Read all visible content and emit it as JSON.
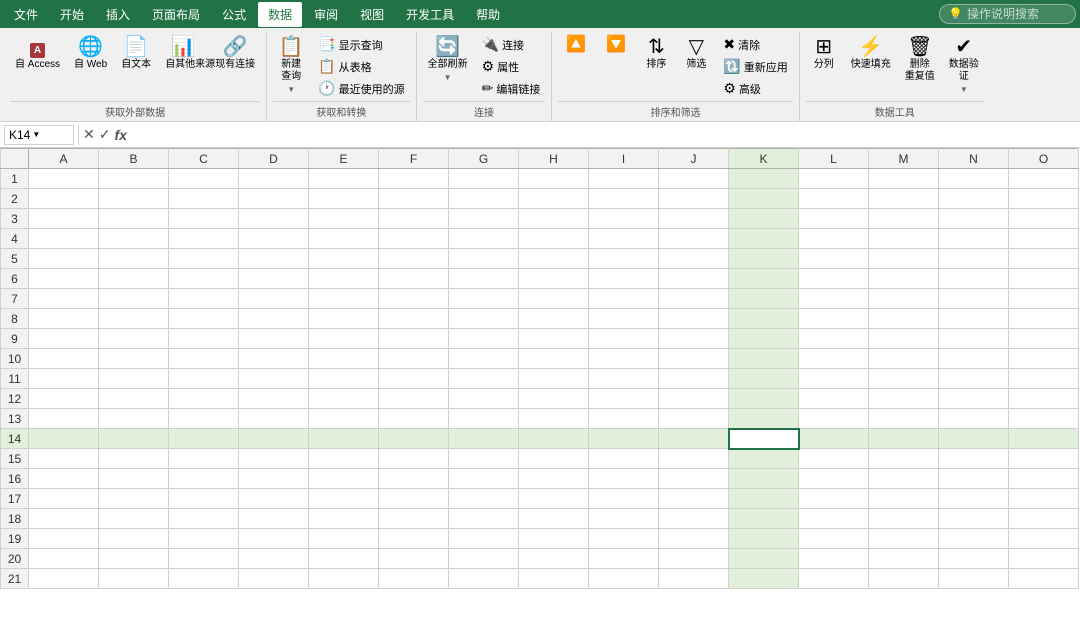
{
  "menu": {
    "items": [
      "文件",
      "开始",
      "插入",
      "页面布局",
      "公式",
      "数据",
      "审阅",
      "视图",
      "开发工具",
      "帮助"
    ],
    "active": "数据",
    "search_placeholder": "操作说明搜索",
    "accent_color": "#217346"
  },
  "ribbon": {
    "groups": [
      {
        "label": "获取外部数据",
        "items_type": "large_with_label",
        "items": [
          {
            "icon": "🅰",
            "label": "自 Access",
            "type": "large"
          },
          {
            "icon": "🌐",
            "label": "自 Web",
            "type": "large"
          },
          {
            "icon": "📄",
            "label": "自文本",
            "type": "large"
          },
          {
            "icon": "📊",
            "label": "自其他来源",
            "type": "large"
          },
          {
            "icon": "🔗",
            "label": "现有连接",
            "type": "large"
          }
        ]
      },
      {
        "label": "获取和转换",
        "items": [
          {
            "icon": "📋",
            "label": "新建查询",
            "type": "large_dropdown"
          },
          {
            "small_items": [
              "显示查询",
              "从表格",
              "最近使用的源"
            ]
          }
        ]
      },
      {
        "label": "连接",
        "items": [
          {
            "icon": "🔄",
            "label": "全部刷新",
            "type": "large_dropdown"
          },
          {
            "small_items": [
              "连接",
              "属性",
              "编辑链接"
            ]
          }
        ]
      },
      {
        "label": "排序和筛选",
        "items": [
          {
            "icon": "↑↓",
            "label": "排序",
            "type": "sort"
          },
          {
            "icon": "▽",
            "label": "筛选",
            "type": "large"
          },
          {
            "small_items": [
              "清除",
              "重新应用",
              "高级"
            ]
          }
        ]
      },
      {
        "label": "数据工具",
        "items": [
          {
            "icon": "⊞",
            "label": "分列",
            "type": "large"
          },
          {
            "icon": "⚡",
            "label": "快速填充",
            "type": "large"
          },
          {
            "icon": "🗑",
            "label": "删除重复值",
            "type": "large"
          },
          {
            "icon": "✔",
            "label": "数据验证",
            "type": "large_dropdown"
          }
        ]
      }
    ]
  },
  "formula_bar": {
    "cell_ref": "K14",
    "formula": "",
    "icons": [
      "✕",
      "✓",
      "fx"
    ]
  },
  "spreadsheet": {
    "selected_cell": "K14",
    "selected_col": "K",
    "selected_row": 14,
    "col_headers": [
      "A",
      "B",
      "C",
      "D",
      "E",
      "F",
      "G",
      "H",
      "I",
      "J",
      "K",
      "L",
      "M",
      "N",
      "O"
    ],
    "row_count": 21
  }
}
